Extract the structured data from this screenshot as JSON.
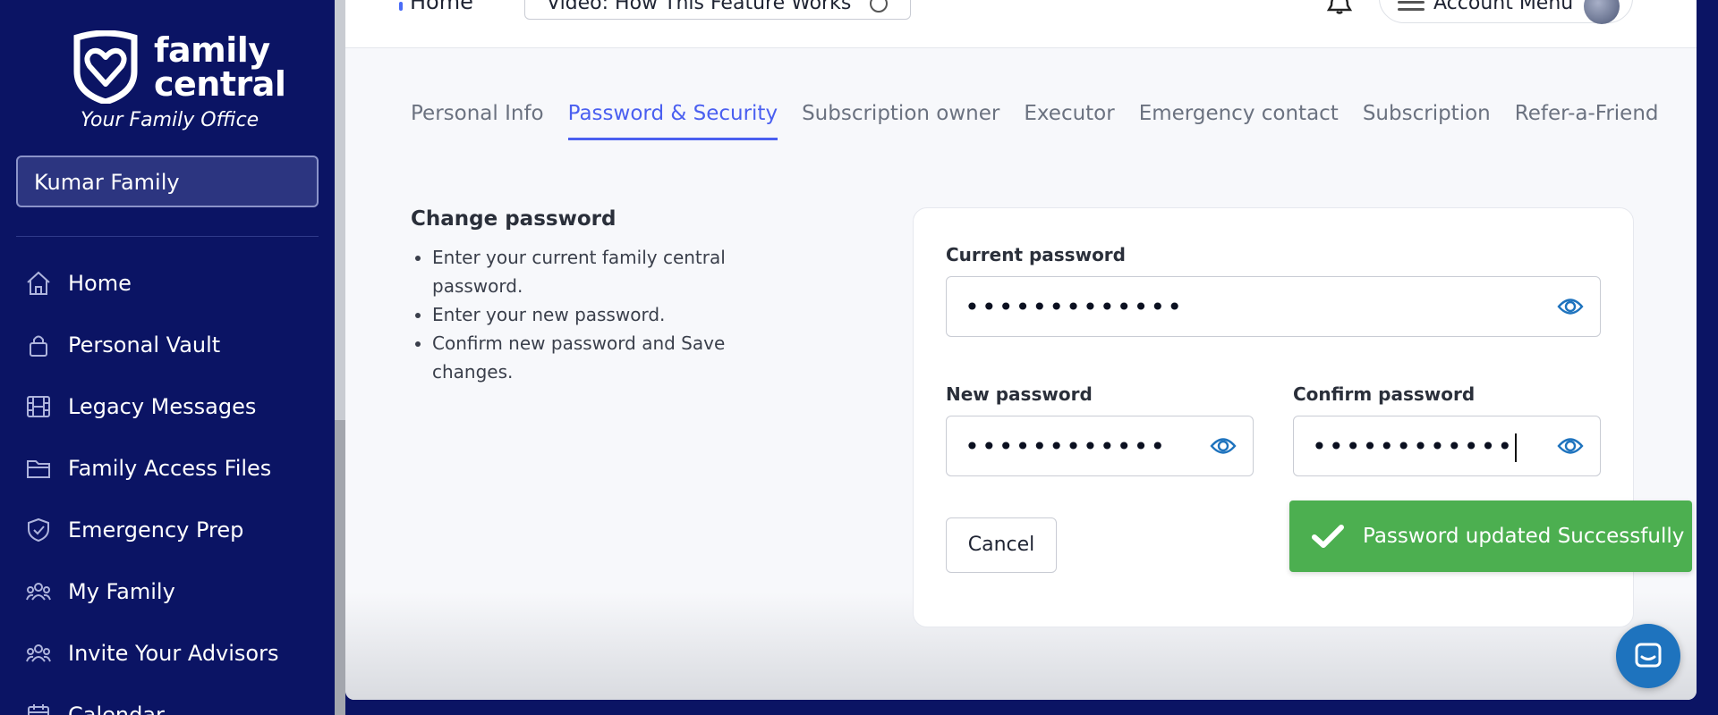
{
  "brand": {
    "name_line1": "family",
    "name_line2": "central",
    "tagline": "Your Family Office"
  },
  "sidebar": {
    "family_selector": "Kumar Family",
    "items": [
      {
        "label": "Home",
        "icon": "home-icon"
      },
      {
        "label": "Personal Vault",
        "icon": "lock-icon"
      },
      {
        "label": "Legacy Messages",
        "icon": "film-icon"
      },
      {
        "label": "Family Access Files",
        "icon": "folder-icon"
      },
      {
        "label": "Emergency Prep",
        "icon": "shield-check-icon"
      },
      {
        "label": "My Family",
        "icon": "users-icon"
      },
      {
        "label": "Invite Your Advisors",
        "icon": "users-icon"
      },
      {
        "label": "Calendar",
        "icon": "calendar-icon"
      }
    ]
  },
  "topbar": {
    "home_label": "Home",
    "video_button": "Video: How This Feature Works",
    "account_menu": "Account Menu"
  },
  "tabs": [
    {
      "label": "Personal Info",
      "active": false
    },
    {
      "label": "Password & Security",
      "active": true
    },
    {
      "label": "Subscription owner",
      "active": false
    },
    {
      "label": "Executor",
      "active": false
    },
    {
      "label": "Emergency contact",
      "active": false
    },
    {
      "label": "Subscription",
      "active": false
    },
    {
      "label": "Refer-a-Friend",
      "active": false
    }
  ],
  "help": {
    "title": "Change password",
    "steps": [
      "Enter your current family central password.",
      "Enter your new password.",
      "Confirm new password and Save changes."
    ]
  },
  "form": {
    "current_label": "Current password",
    "current_value": "•••••••••••••",
    "new_label": "New password",
    "new_value": "••••••••••••",
    "confirm_label": "Confirm password",
    "confirm_value": "••••••••••••",
    "cancel_label": "Cancel"
  },
  "toast": {
    "message": "Password updated Successfully",
    "color": "#4caf50"
  },
  "colors": {
    "sidebar_bg": "#0b1464",
    "accent": "#4a5ff0"
  }
}
